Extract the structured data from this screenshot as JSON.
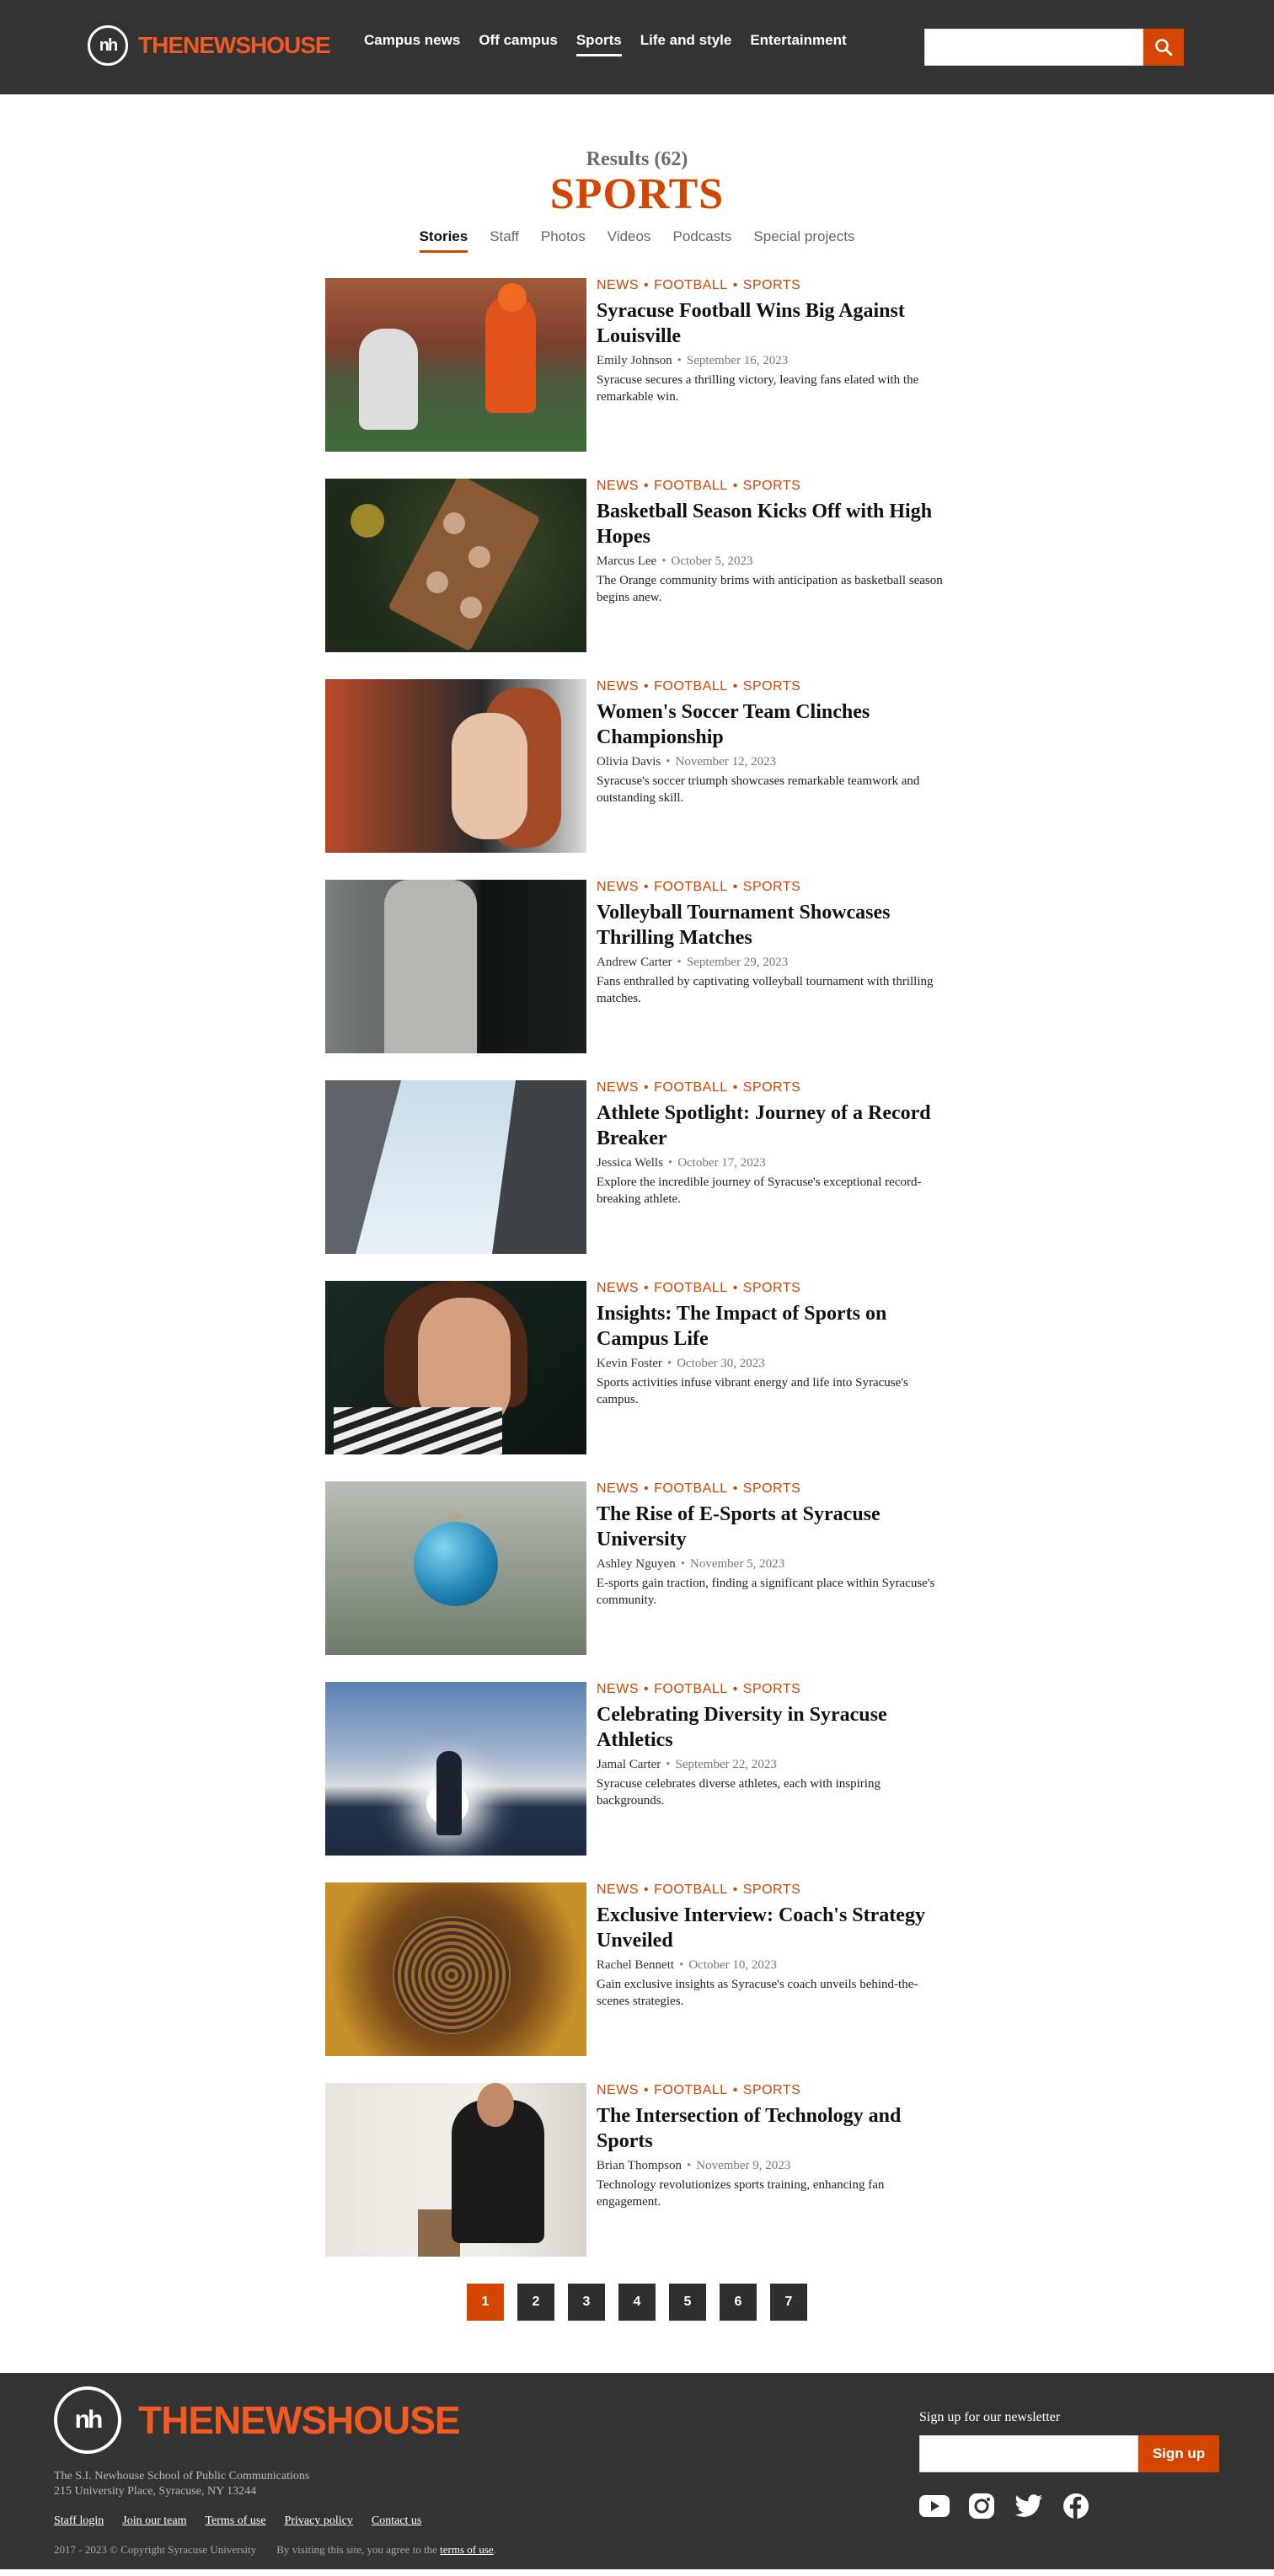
{
  "header": {
    "logo_monogram": "nh",
    "wordmark_the": "THE",
    "wordmark_news": "NEWS",
    "wordmark_house": "HOUSE",
    "nav": [
      "Campus news",
      "Off campus",
      "Sports",
      "Life and style",
      "Entertainment"
    ],
    "active_nav": "Sports",
    "search_placeholder": "",
    "search_icon": "search-icon"
  },
  "results": {
    "count": "Results (62)",
    "title": "SPORTS",
    "tabs": [
      "Stories",
      "Staff",
      "Photos",
      "Videos",
      "Podcasts",
      "Special projects"
    ],
    "active_tab": "Stories"
  },
  "stories": [
    {
      "tags": [
        "NEWS",
        "FOOTBALL",
        "SPORTS"
      ],
      "title": "Syracuse Football Wins Big Against Louisville",
      "author": "Emily Johnson",
      "date": "September 16, 2023",
      "teaser": "Syracuse secures a thrilling victory, leaving fans elated with the remarkable win."
    },
    {
      "tags": [
        "NEWS",
        "FOOTBALL",
        "SPORTS"
      ],
      "title": "Basketball Season Kicks Off with High Hopes",
      "author": "Marcus Lee",
      "date": "October 5, 2023",
      "teaser": "The Orange community brims with anticipation as basketball season begins anew."
    },
    {
      "tags": [
        "NEWS",
        "FOOTBALL",
        "SPORTS"
      ],
      "title": "Women's Soccer Team Clinches Championship",
      "author": "Olivia Davis",
      "date": "November 12, 2023",
      "teaser": "Syracuse's soccer triumph showcases remarkable teamwork and outstanding skill."
    },
    {
      "tags": [
        "NEWS",
        "FOOTBALL",
        "SPORTS"
      ],
      "title": "Volleyball Tournament Showcases Thrilling Matches",
      "author": "Andrew Carter",
      "date": "September 29, 2023",
      "teaser": "Fans enthralled by captivating volleyball tournament with thrilling matches."
    },
    {
      "tags": [
        "NEWS",
        "FOOTBALL",
        "SPORTS"
      ],
      "title": "Athlete Spotlight: Journey of a Record Breaker",
      "author": "Jessica Wells",
      "date": "October 17, 2023",
      "teaser": "Explore the incredible journey of Syracuse's exceptional record-breaking athlete."
    },
    {
      "tags": [
        "NEWS",
        "FOOTBALL",
        "SPORTS"
      ],
      "title": "Insights: The Impact of Sports on Campus Life",
      "author": "Kevin Foster",
      "date": "October 30, 2023",
      "teaser": "Sports activities infuse vibrant energy and life into Syracuse's campus."
    },
    {
      "tags": [
        "NEWS",
        "FOOTBALL",
        "SPORTS"
      ],
      "title": "The Rise of E-Sports at Syracuse University",
      "author": "Ashley Nguyen",
      "date": "November 5, 2023",
      "teaser": "E-sports gain traction, finding a significant place within Syracuse's community."
    },
    {
      "tags": [
        "NEWS",
        "FOOTBALL",
        "SPORTS"
      ],
      "title": "Celebrating Diversity in Syracuse Athletics",
      "author": "Jamal Carter",
      "date": "September 22, 2023",
      "teaser": "Syracuse celebrates diverse athletes, each with inspiring backgrounds."
    },
    {
      "tags": [
        "NEWS",
        "FOOTBALL",
        "SPORTS"
      ],
      "title": "Exclusive Interview: Coach's Strategy Unveiled",
      "author": "Rachel Bennett",
      "date": "October 10, 2023",
      "teaser": "Gain exclusive insights as Syracuse's coach unveils behind-the-scenes strategies."
    },
    {
      "tags": [
        "NEWS",
        "FOOTBALL",
        "SPORTS"
      ],
      "title": "The Intersection of Technology and Sports",
      "author": "Brian Thompson",
      "date": "November 9, 2023",
      "teaser": "Technology revolutionizes sports training, enhancing fan engagement."
    }
  ],
  "pagination": {
    "pages": [
      "1",
      "2",
      "3",
      "4",
      "5",
      "6",
      "7"
    ],
    "current": "1"
  },
  "footer": {
    "logo_monogram": "nh",
    "wordmark_the": "THE",
    "wordmark_news": "NEWS",
    "wordmark_house": "HOUSE",
    "school_line1": "The S.I. Newhouse School of Public Communications",
    "school_line2": "215 University Place, Syracuse, NY 13244",
    "links": [
      "Staff login",
      "Join our team",
      "Terms of use",
      "Privacy policy",
      "Contact us"
    ],
    "copyright": "2017 - 2023 © Copyright Syracuse University",
    "agree_prefix": "By visiting this site, you agree to the",
    "agree_link": "terms of use",
    "agree_suffix": ".",
    "newsletter_label": "Sign up for our newsletter",
    "newsletter_placeholder": "",
    "newsletter_button": "Sign up",
    "social": [
      "youtube-icon",
      "instagram-icon",
      "twitter-icon",
      "facebook-icon"
    ]
  },
  "colors": {
    "accent": "#d44500",
    "header_bg": "#333333",
    "brand_orange": "#f15a22"
  }
}
